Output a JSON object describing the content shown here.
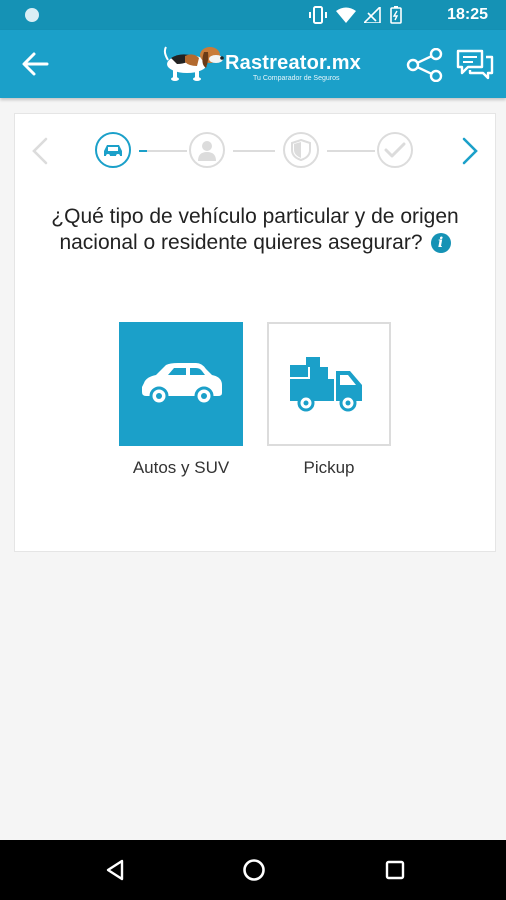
{
  "status_bar": {
    "time": "18:25"
  },
  "app_bar": {
    "brand": "Rastreator.mx",
    "tagline": "Tu Comparador de Seguros"
  },
  "question": {
    "text": "¿Qué tipo de vehículo particular y de origen nacional o residente quieres asegurar?",
    "info_symbol": "i"
  },
  "steps": [
    {
      "icon": "car-icon",
      "state": "active"
    },
    {
      "icon": "person-icon",
      "state": "inactive"
    },
    {
      "icon": "shield-icon",
      "state": "inactive"
    },
    {
      "icon": "check-icon",
      "state": "inactive"
    }
  ],
  "options": [
    {
      "label": "Autos y SUV",
      "icon": "car-icon",
      "selected": true
    },
    {
      "label": "Pickup",
      "icon": "pickup-truck-icon",
      "selected": false
    }
  ],
  "colors": {
    "primary": "#1ba0c9",
    "status_bar": "#1592b5",
    "inactive": "#dcdcdc",
    "background": "#f5f5f5"
  }
}
